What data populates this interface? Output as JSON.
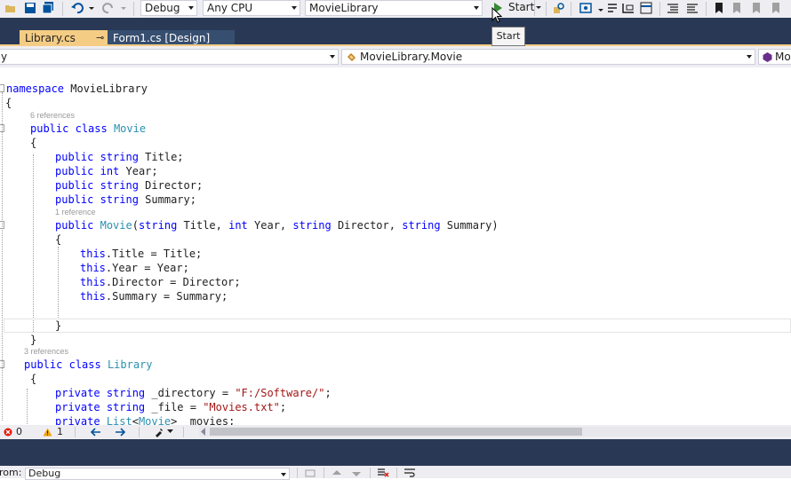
{
  "toolbar": {
    "config": "Debug",
    "platform": "Any CPU",
    "project": "MovieLibrary",
    "start_label": "Start"
  },
  "tooltip": "Start",
  "tabs": [
    {
      "label": "Library.cs",
      "pin": "⊸"
    },
    {
      "label": "Form1.cs [Design]"
    }
  ],
  "nav": {
    "left": "y",
    "middle": "MovieLibrary.Movie",
    "right": "Mo"
  },
  "code": {
    "namespace_kw": "namespace",
    "namespace_name": " MovieLibrary",
    "open_brace": "{",
    "close_brace": "}",
    "lens_movie": "6 references",
    "lens_ctor": "1 reference",
    "lens_library": "3 references",
    "public": "public",
    "class": "class",
    "string": "string",
    "int": "int",
    "this": "this",
    "private": "private",
    "movie": "Movie",
    "library": "Library",
    "list": "List",
    "title_decl": " Title;",
    "year_decl": " Year;",
    "director_decl": " Director;",
    "summary_decl": " Summary;",
    "ctor_p1": " Title, ",
    "ctor_p2": " Year, ",
    "ctor_p3": " Director, ",
    "ctor_p4": " Summary)",
    "assign_title": ".Title = Title;",
    "assign_year": ".Year = Year;",
    "assign_director": ".Director = Director;",
    "assign_summary": ".Summary = Summary;",
    "dir_field": " _directory = ",
    "dir_value": "\"F:/Software/\"",
    "file_field": " _file = ",
    "file_value": "\"Movies.txt\"",
    "semicolon": ";",
    "movies_field": "> _movies;"
  },
  "status": {
    "errors": "0",
    "warnings": "1"
  },
  "output": {
    "from_label": "rom:",
    "from_value": "Debug"
  }
}
